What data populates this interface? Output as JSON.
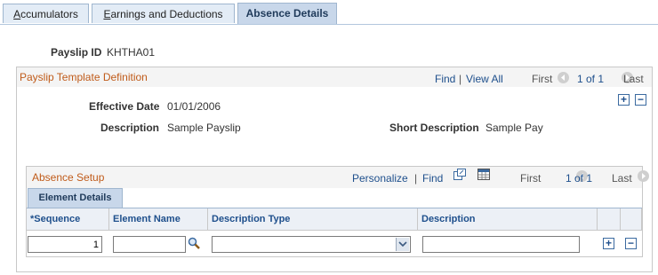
{
  "tabs": [
    {
      "label_prefix": "",
      "label_u": "A",
      "label_rest": "ccumulators"
    },
    {
      "label_prefix": "",
      "label_u": "E",
      "label_rest": "arnings and Deductions"
    },
    {
      "label_prefix": "",
      "label_u": "",
      "label_rest": "Absence Details"
    }
  ],
  "payslip": {
    "label": "Payslip ID",
    "value": "KHTHA01"
  },
  "template": {
    "title": "Payslip Template Definition",
    "find": "Find",
    "sep": "|",
    "view_all": "View All",
    "first": "First",
    "count": "1 of 1",
    "last": "Last",
    "effective_date_label": "Effective Date",
    "effective_date_value": "01/01/2006",
    "description_label": "Description",
    "description_value": "Sample Payslip",
    "short_description_label": "Short Description",
    "short_description_value": "Sample Pay"
  },
  "absence": {
    "title": "Absence Setup",
    "personalize": "Personalize",
    "sep": "|",
    "find": "Find",
    "first": "First",
    "count": "1 of 1",
    "last": "Last",
    "subtab": "Element Details",
    "columns": [
      "*Sequence",
      "Element Name",
      "Description Type",
      "Description"
    ],
    "row": {
      "sequence": "1",
      "element_name": "",
      "description_type": "",
      "description": ""
    }
  },
  "icons": {
    "add": "plus-icon",
    "delete": "minus-icon",
    "lookup": "magnifier-icon",
    "zoom": "zoom-icon",
    "download": "grid-download-icon",
    "nav_prev": "arrow-left-icon",
    "nav_next": "arrow-right-icon"
  },
  "colors": {
    "accent": "#1e4f8c",
    "section_title": "#c05b1a",
    "tab_active": "#c8d7ea"
  }
}
